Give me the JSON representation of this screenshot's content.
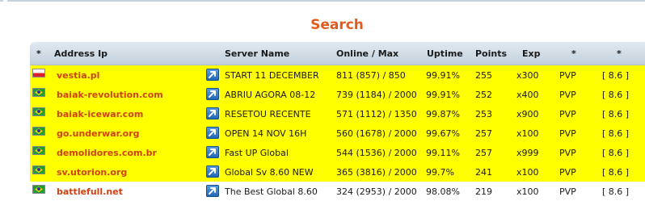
{
  "title": "Search",
  "columns": {
    "star1": "*",
    "address": "Address Ip",
    "server": "Server Name",
    "online": "Online / Max",
    "uptime": "Uptime",
    "points": "Points",
    "exp": "Exp",
    "star2": "*",
    "star3": "*"
  },
  "colors": {
    "title": "#e35b1c",
    "address": "#d1410f",
    "highlight": "#ffff00",
    "header": "#c3d1dc"
  },
  "rows": [
    {
      "flag": "poland-flag-icon",
      "address": "vestia.pl",
      "server": "START 11 DECEMBER",
      "online": "811 (857) / 850",
      "uptime": "99.91%",
      "points": "255",
      "exp": "x300",
      "type": "PVP",
      "version": "[ 8.6 ]",
      "highlighted": true
    },
    {
      "flag": "brazil-flag-icon",
      "address": "baiak-revolution.com",
      "server": "ABRIU AGORA 08-12",
      "online": "739 (1184) / 2000",
      "uptime": "99.91%",
      "points": "252",
      "exp": "x400",
      "type": "PVP",
      "version": "[ 8.6 ]",
      "highlighted": true
    },
    {
      "flag": "brazil-flag-icon",
      "address": "baiak-icewar.com",
      "server": "RESETOU RECENTE",
      "online": "571 (1112) / 1350",
      "uptime": "99.87%",
      "points": "253",
      "exp": "x900",
      "type": "PVP",
      "version": "[ 8.6 ]",
      "highlighted": true
    },
    {
      "flag": "brazil-flag-icon",
      "address": "go.underwar.org",
      "server": "OPEN 14 NOV 16H",
      "online": "560 (1678) / 2000",
      "uptime": "99.67%",
      "points": "257",
      "exp": "x100",
      "type": "PVP",
      "version": "[ 8.6 ]",
      "highlighted": true
    },
    {
      "flag": "brazil-flag-icon",
      "address": "demolidores.com.br",
      "server": "Fast UP Global",
      "online": "544 (1536) / 2000",
      "uptime": "99.11%",
      "points": "257",
      "exp": "x999",
      "type": "PVP",
      "version": "[ 8.6 ]",
      "highlighted": true
    },
    {
      "flag": "brazil-flag-icon",
      "address": "sv.utorion.org",
      "server": "Global Sv 8.60 NEW",
      "online": "365 (3816) / 2000",
      "uptime": "99.7%",
      "points": "241",
      "exp": "x100",
      "type": "PVP",
      "version": "[ 8.6 ]",
      "highlighted": true
    },
    {
      "flag": "brazil-flag-icon",
      "address": "battlefull.net",
      "server": "The Best Global 8.60",
      "online": "324 (2953) / 2000",
      "uptime": "98.08%",
      "points": "219",
      "exp": "x100",
      "type": "PVP",
      "version": "[ 8.6 ]",
      "highlighted": false
    }
  ]
}
